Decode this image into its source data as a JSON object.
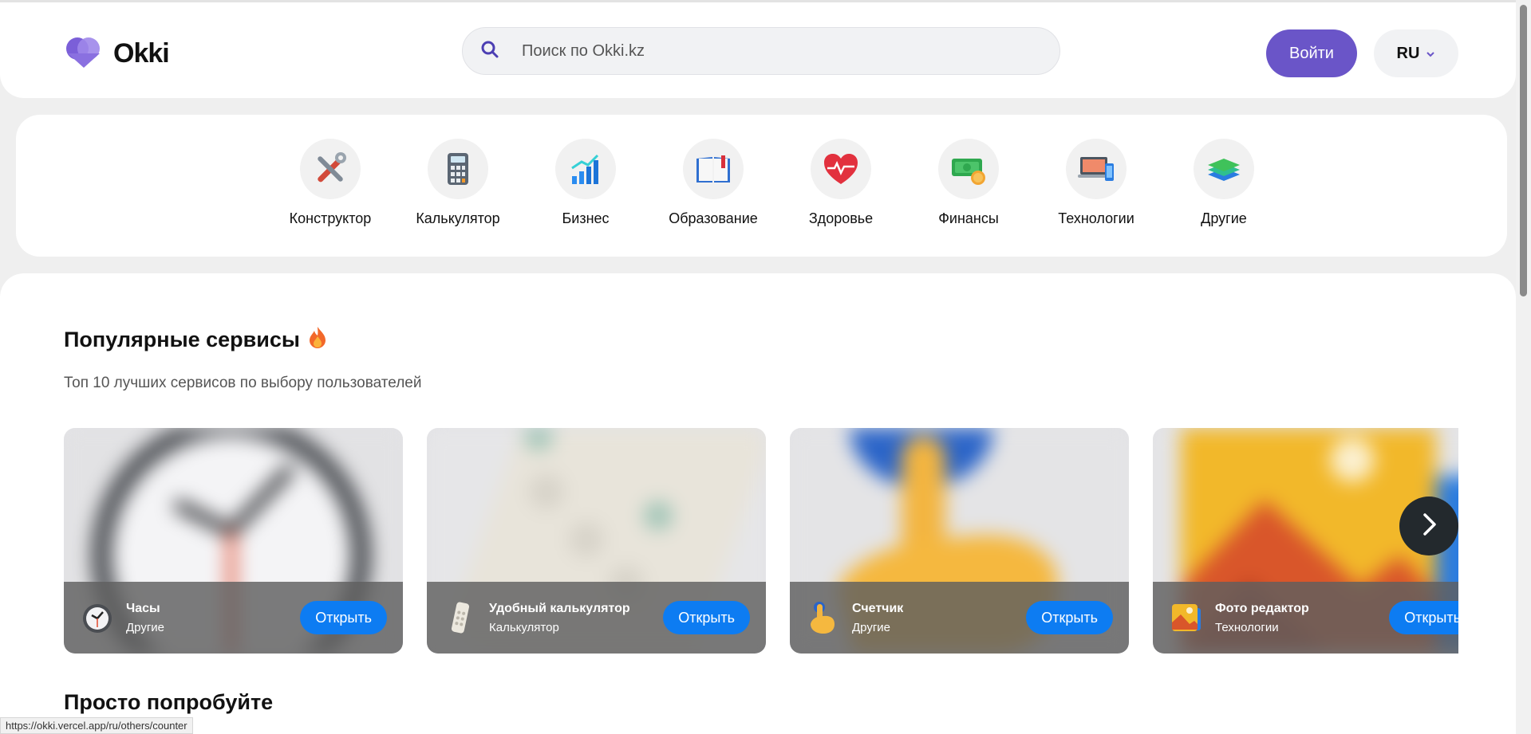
{
  "header": {
    "logo_text": "Okki",
    "search_placeholder": "Поиск по Okki.kz",
    "login_label": "Войти",
    "lang_label": "RU"
  },
  "categories": [
    {
      "label": "Конструктор",
      "icon": "tools-icon"
    },
    {
      "label": "Калькулятор",
      "icon": "calculator-icon"
    },
    {
      "label": "Бизнес",
      "icon": "bar-chart-icon"
    },
    {
      "label": "Образование",
      "icon": "book-icon"
    },
    {
      "label": "Здоровье",
      "icon": "heart-pulse-icon"
    },
    {
      "label": "Финансы",
      "icon": "money-icon"
    },
    {
      "label": "Технологии",
      "icon": "devices-icon"
    },
    {
      "label": "Другие",
      "icon": "layers-icon"
    }
  ],
  "popular": {
    "title": "Популярные сервисы",
    "title_icon": "fire-icon",
    "subtitle": "Топ 10 лучших сервисов по выбору пользователей",
    "cards": [
      {
        "name": "Часы",
        "category": "Другие",
        "button": "Открыть",
        "icon": "clock-icon"
      },
      {
        "name": "Удобный калькулятор",
        "category": "Калькулятор",
        "button": "Открыть",
        "icon": "calculator-icon"
      },
      {
        "name": "Счетчик",
        "category": "Другие",
        "button": "Открыть",
        "icon": "pointing-hand-icon"
      },
      {
        "name": "Фото редактор",
        "category": "Технологии",
        "button": "Открыть",
        "icon": "picture-icon"
      }
    ]
  },
  "try_section": {
    "title": "Просто попробуйте"
  },
  "status_url": "https://okki.vercel.app/ru/others/counter",
  "colors": {
    "brand": "#6a55c8",
    "accent": "#0d7cf2"
  }
}
